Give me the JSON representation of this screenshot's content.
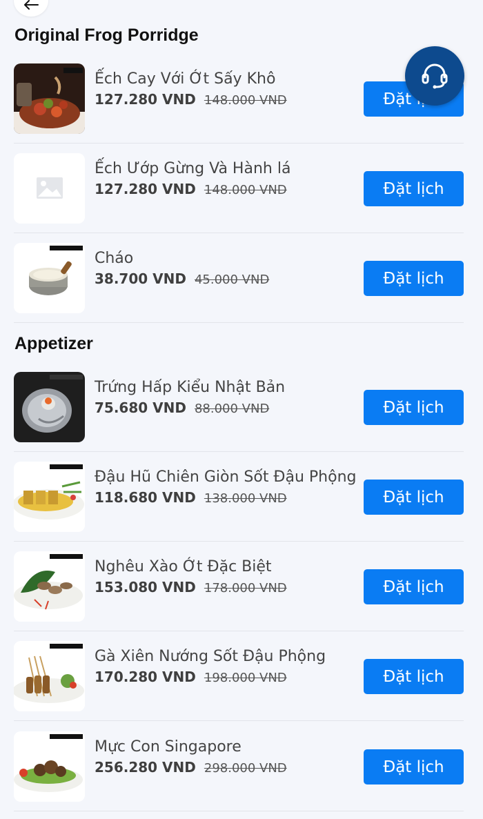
{
  "nav": {
    "back_icon": "arrow-left-icon"
  },
  "support": {
    "icon": "headset-icon",
    "color": "#0d4a8e"
  },
  "accent_color": "#0a7cf3",
  "sections": [
    {
      "title": "Original Frog Porridge",
      "items": [
        {
          "name": "Ếch Cay Với Ớt Sấy Khô",
          "price": "127.280 VND",
          "old_price": "148.000 VND",
          "button": "Đặt lịch"
        },
        {
          "name": "Ếch Ướp Gừng Và Hành lá",
          "price": "127.280 VND",
          "old_price": "148.000 VND",
          "button": "Đặt lịch"
        },
        {
          "name": "Cháo",
          "price": "38.700 VND",
          "old_price": "45.000 VND",
          "button": "Đặt lịch"
        }
      ]
    },
    {
      "title": "Appetizer",
      "items": [
        {
          "name": "Trứng Hấp Kiểu Nhật Bản",
          "price": "75.680 VND",
          "old_price": "88.000 VND",
          "button": "Đặt lịch"
        },
        {
          "name": "Đậu Hũ Chiên Giòn Sốt Đậu Phộng",
          "price": "118.680 VND",
          "old_price": "138.000 VND",
          "button": "Đặt lịch"
        },
        {
          "name": "Nghêu Xào Ớt Đặc Biệt",
          "price": "153.080 VND",
          "old_price": "178.000 VND",
          "button": "Đặt lịch"
        },
        {
          "name": "Gà Xiên Nướng Sốt Đậu Phộng",
          "price": "170.280 VND",
          "old_price": "198.000 VND",
          "button": "Đặt lịch"
        },
        {
          "name": "Mực Con Singapore",
          "price": "256.280 VND",
          "old_price": "298.000 VND",
          "button": "Đặt lịch"
        }
      ]
    }
  ]
}
